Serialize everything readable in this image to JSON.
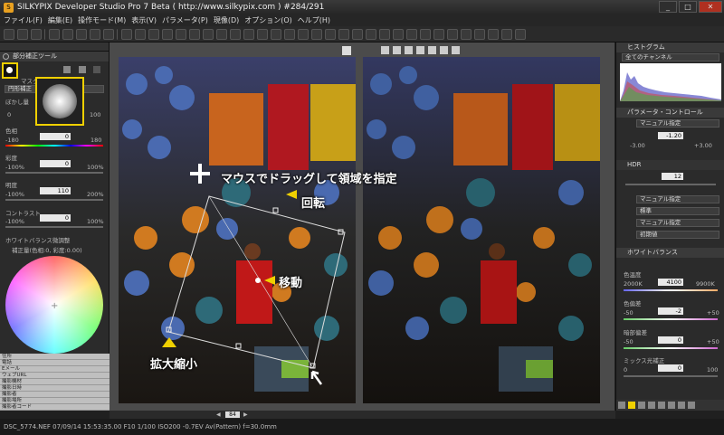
{
  "window": {
    "title": "SILKYPIX Developer Studio Pro 7 Beta ( http://www.silkypix.com )    #284/291",
    "icon": "app-icon",
    "controls": [
      "minimize-icon",
      "maximize-icon",
      "close-icon"
    ]
  },
  "menu": [
    "ファイル(F)",
    "編集(E)",
    "操作モード(M)",
    "表示(V)",
    "パラメータ(P)",
    "現像(D)",
    "オプション(O)",
    "ヘルプ(H)"
  ],
  "left": {
    "tool_title": "部分補正ツール",
    "mask_type_label": "マスクタ",
    "mask_type": "円形補正",
    "feather_label": "ぼかし量",
    "feather_min": "0",
    "feather_max": "100",
    "hue_label": "色相",
    "hue_min": "-180",
    "hue_value": "0",
    "hue_max": "180",
    "sat_label": "彩度",
    "sat_min": "-100%",
    "sat_value": "0",
    "sat_max": "100%",
    "bright_label": "明度",
    "bright_min": "-100%",
    "bright_value": "110",
    "bright_max": "200%",
    "contrast_label": "コントラスト",
    "contrast_min": "-100%",
    "contrast_value": "0",
    "contrast_max": "100%",
    "wb_label": "ホワイトバランス微調整",
    "wb_readout": "補正量(色相:0, 彩度:0.00)",
    "meta_items": [
      "住所",
      "電話",
      "Eメール",
      "ウェブURL",
      "撮影機材",
      "撮影日時",
      "撮影者",
      "撮影場所",
      "撮影者コード"
    ]
  },
  "annotations": {
    "drag": "マウスでドラッグして領域を指定",
    "rotate": "回転",
    "move": "移動",
    "scale": "拡大縮小"
  },
  "bottom": {
    "zoom": "84"
  },
  "right": {
    "histogram_title": "ヒストグラム",
    "channel": "全てのチャンネル",
    "param_title": "パラメータ・コントロール",
    "preset": "マニュアル指定",
    "exposure_min": "-3.00",
    "exposure_value": "-1.20",
    "exposure_max": "+3.00",
    "hdr_label": "HDR",
    "hdr_value": "12",
    "tone_preset": "マニュアル指定",
    "standard": "標準",
    "sharp_preset": "マニュアル指定",
    "initial": "初期値",
    "wb_title": "ホワイトバランス",
    "temp_label": "色温度",
    "temp_min": "2000K",
    "temp_value": "4100",
    "temp_max": "9900K",
    "tint_label": "色偏差",
    "tint_min": "-50",
    "tint_value": "-2",
    "tint_max": "+50",
    "dark_label": "暗部偏差",
    "dark_min": "-50",
    "dark_value": "0",
    "dark_max": "+50",
    "mix_label": "ミックス光補正",
    "mix_min": "0",
    "mix_value": "0",
    "mix_max": "100"
  },
  "status": "DSC_5774.NEF 07/09/14 15:53:35.00 F10 1/100 ISO200 -0.7EV Av(Pattern) f=30.0mm",
  "colors": {
    "accent": "#f0d000",
    "panel": "#2b2b2b",
    "viewer": "#4b4b4b"
  }
}
